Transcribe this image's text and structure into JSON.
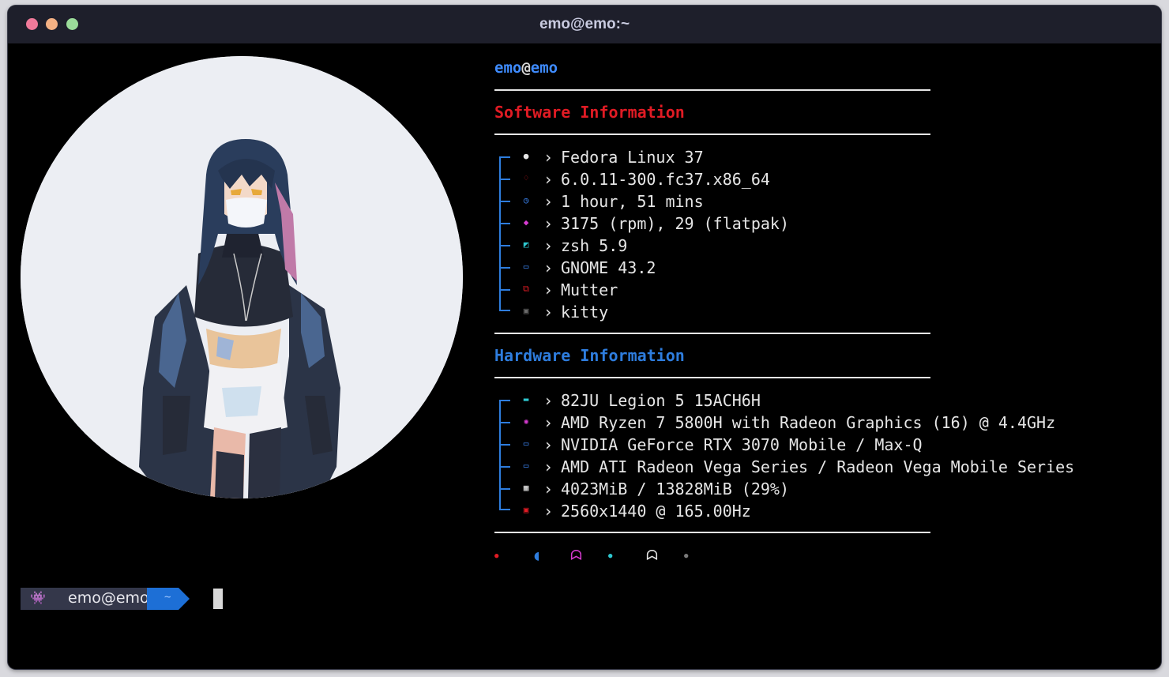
{
  "window": {
    "title": "emo@emo:~"
  },
  "user": {
    "name": "emo",
    "at": "@",
    "host": "emo"
  },
  "software": {
    "title": "Software Information",
    "color": "#e01b24",
    "items": [
      {
        "icon": "fedora-icon",
        "glyph": "●",
        "color": "#e6e6e6",
        "value": "Fedora Linux 37"
      },
      {
        "icon": "kernel-icon",
        "glyph": "♢",
        "color": "#e01b24",
        "value": "6.0.11-300.fc37.x86_64"
      },
      {
        "icon": "clock-icon",
        "glyph": "◷",
        "color": "#3f8cff",
        "value": "1 hour, 51 mins"
      },
      {
        "icon": "package-icon",
        "glyph": "◆",
        "color": "#d83bd2",
        "value": "3175 (rpm), 29 (flatpak)"
      },
      {
        "icon": "shell-icon",
        "glyph": "◩",
        "color": "#2ec8d0",
        "value": "zsh 5.9"
      },
      {
        "icon": "desktop-icon",
        "glyph": "▭",
        "color": "#3f8cff",
        "value": "GNOME 43.2"
      },
      {
        "icon": "windows-icon",
        "glyph": "⧉",
        "color": "#e01b24",
        "value": "Mutter"
      },
      {
        "icon": "terminal-icon",
        "glyph": "▣",
        "color": "#6a6a6a",
        "value": "kitty"
      }
    ]
  },
  "hardware": {
    "title": "Hardware Information",
    "color": "#2e7dde",
    "items": [
      {
        "icon": "laptop-icon",
        "glyph": "▬",
        "color": "#2ec8d0",
        "value": "82JU Legion 5 15ACH6H"
      },
      {
        "icon": "cpu-icon",
        "glyph": "✺",
        "color": "#d83bd2",
        "value": "AMD Ryzen 7 5800H with Radeon Graphics (16) @ 4.4GHz"
      },
      {
        "icon": "gpu-icon",
        "glyph": "▭",
        "color": "#3f8cff",
        "value": "NVIDIA GeForce RTX 3070 Mobile / Max-Q"
      },
      {
        "icon": "gpu-icon",
        "glyph": "▭",
        "color": "#3f8cff",
        "value": "AMD ATI Radeon Vega Series / Radeon Vega Mobile Series"
      },
      {
        "icon": "memory-icon",
        "glyph": "▦",
        "color": "#e6e6e6",
        "value": "4023MiB / 13828MiB (29%)"
      },
      {
        "icon": "display-icon",
        "glyph": "▣",
        "color": "#e01b24",
        "value": "2560x1440 @ 165.00Hz"
      }
    ]
  },
  "chevron": "›",
  "pacman": [
    {
      "name": "red-dot",
      "glyph": "●",
      "color": "#e01b24"
    },
    {
      "name": "pacman-icon",
      "glyph": "◖",
      "color": "#2e7dde"
    },
    {
      "name": "ghost-magenta-icon",
      "glyph": "ᗣ",
      "color": "#d83bd2"
    },
    {
      "name": "cyan-dot",
      "glyph": "●",
      "color": "#2ec8d0"
    },
    {
      "name": "ghost-white-icon",
      "glyph": "ᗣ",
      "color": "#e6e6e6"
    },
    {
      "name": "gray-dot",
      "glyph": "●",
      "color": "#7a7a7a"
    }
  ],
  "prompt": {
    "icon": "space-invader-icon",
    "glyph": "👾",
    "user": "emo@emo",
    "dir": "~"
  }
}
